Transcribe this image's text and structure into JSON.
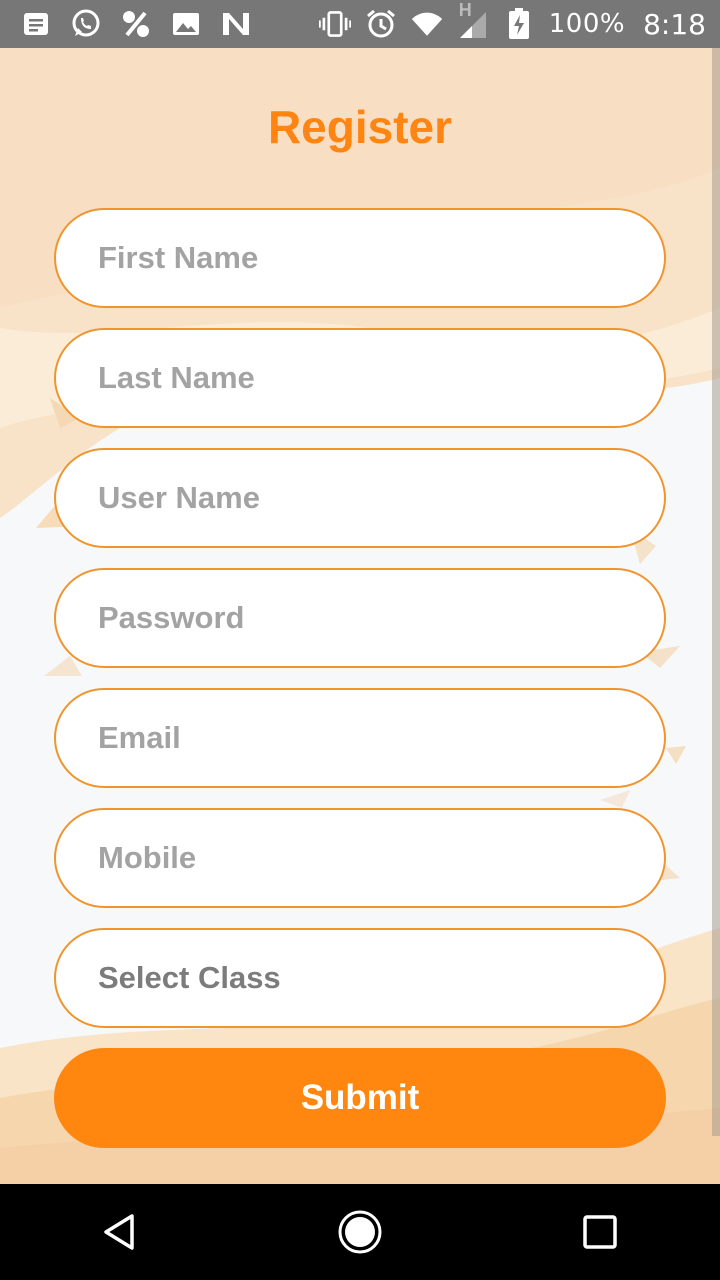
{
  "status_bar": {
    "battery": "100%",
    "time": "8:18",
    "network_type": "H",
    "icons_left": [
      "notes-icon",
      "whatsapp-icon",
      "percent-icon",
      "image-icon",
      "n-app-icon"
    ],
    "icons_right": [
      "vibrate-icon",
      "alarm-icon",
      "wifi-icon",
      "signal-icon",
      "battery-charging-icon"
    ]
  },
  "form": {
    "title": "Register",
    "fields": {
      "first_name": {
        "placeholder": "First Name",
        "value": ""
      },
      "last_name": {
        "placeholder": "Last Name",
        "value": ""
      },
      "user_name": {
        "placeholder": "User Name",
        "value": ""
      },
      "password": {
        "placeholder": "Password",
        "value": ""
      },
      "email": {
        "placeholder": "Email",
        "value": ""
      },
      "mobile": {
        "placeholder": "Mobile",
        "value": ""
      }
    },
    "select_class": {
      "label": "Select Class"
    },
    "submit_label": "Submit"
  },
  "nav_bar": {
    "buttons": [
      "back-icon",
      "home-icon",
      "recents-icon"
    ]
  },
  "colors": {
    "accent": "#ff860f",
    "title": "#ff8512",
    "field_border": "#f0952e",
    "background_light": "#f6f8f9",
    "background_warm": "#f8e2c6"
  }
}
